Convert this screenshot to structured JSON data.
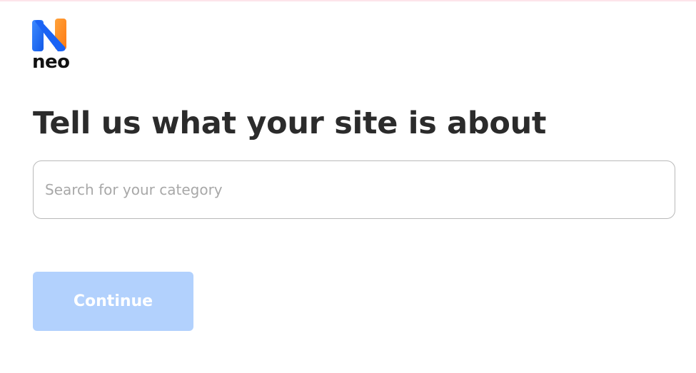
{
  "brand": {
    "name": "neo",
    "icon": "neo-logo-icon",
    "colors": {
      "blue": "#1f6bff",
      "orange": "#ff8a1f",
      "text": "#111111"
    }
  },
  "page": {
    "title": "Tell us what your site is about"
  },
  "search": {
    "placeholder": "Search for your category",
    "value": ""
  },
  "actions": {
    "continue_label": "Continue",
    "continue_color": "#b2d1fd"
  }
}
